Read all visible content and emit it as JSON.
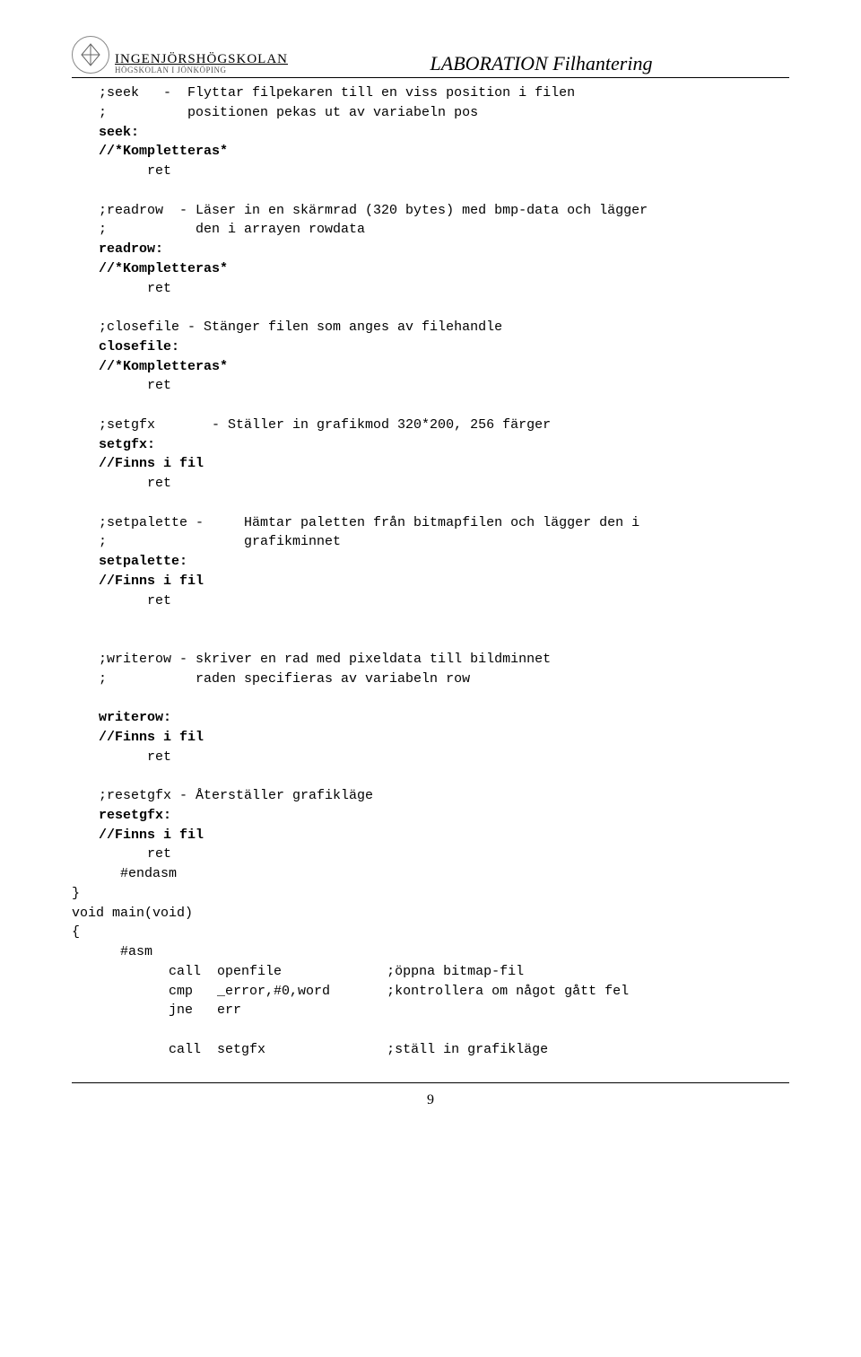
{
  "header": {
    "school_name": "INGENJÖRSHÖGSKOLAN",
    "school_sub": "HÖGSKOLAN I JÖNKÖPING",
    "doc_title": "LABORATION Filhantering"
  },
  "lines": {
    "seek_c1": ";seek   -  Flyttar filpekaren till en viss position i filen",
    "seek_c2": ";          positionen pekas ut av variabeln pos",
    "seek_lbl": "seek:",
    "kompl": "//*Kompletteras*",
    "ret": "ret",
    "readrow_c1": ";readrow  - Läser in en skärmrad (320 bytes) med bmp-data och lägger",
    "readrow_c2": ";           den i arrayen rowdata",
    "readrow_lbl": "readrow:",
    "closefile_c1": ";closefile - Stänger filen som anges av filehandle",
    "closefile_lbl": "closefile:",
    "setgfx_c1": ";setgfx       - Ställer in grafikmod 320*200, 256 färger",
    "setgfx_lbl": "setgfx:",
    "finns": "//Finns i fil",
    "setpal_c1": ";setpalette -     Hämtar paletten från bitmapfilen och lägger den i",
    "setpal_c2": ";                 grafikminnet",
    "setpal_lbl": "setpalette:",
    "writerow_c1": ";writerow - skriver en rad med pixeldata till bildminnet",
    "writerow_c2": ";           raden specifieras av variabeln row",
    "writerow_lbl": "writerow:",
    "resetgfx_c1": ";resetgfx - Återställer grafikläge",
    "resetgfx_lbl": "resetgfx:",
    "endasm": "#endasm",
    "brace_close": "}",
    "void_main": "void main(void)",
    "brace_open": "{",
    "asm": "#asm",
    "call_open": "call  openfile             ;öppna bitmap-fil",
    "cmp_err": "cmp   _error,#0,word       ;kontrollera om något gått fel",
    "jne_err": "jne   err",
    "call_setgfx": "call  setgfx               ;ställ in grafikläge"
  },
  "page_number": "9"
}
